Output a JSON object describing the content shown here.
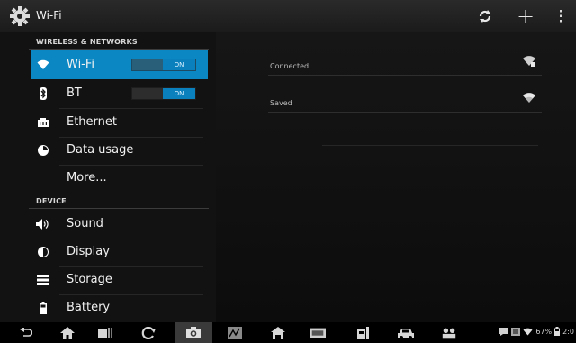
{
  "action_bar": {
    "title": "Wi-Fi",
    "icons": [
      "settings-gear-icon",
      "wps-icon",
      "add-icon",
      "overflow-menu-icon"
    ],
    "add_label": "+"
  },
  "sidebar": {
    "sections": [
      {
        "title": "WIRELESS & NETWORKS"
      },
      {
        "title": "DEVICE"
      }
    ],
    "items": [
      {
        "label": "Wi-Fi",
        "icon": "wifi-icon",
        "toggle": "ON",
        "selected": true
      },
      {
        "label": "BT",
        "icon": "bluetooth-icon",
        "toggle": "ON"
      },
      {
        "label": "Ethernet",
        "icon": "ethernet-icon"
      },
      {
        "label": "Data usage",
        "icon": "data-usage-icon"
      },
      {
        "label": "More...",
        "icon": ""
      },
      {
        "label": "Sound",
        "icon": "sound-icon"
      },
      {
        "label": "Display",
        "icon": "display-icon"
      },
      {
        "label": "Storage",
        "icon": "storage-icon"
      },
      {
        "label": "Battery",
        "icon": "battery-icon"
      }
    ]
  },
  "networks": [
    {
      "label": "Connected",
      "icon": "wifi-lock-icon"
    },
    {
      "label": "Saved",
      "icon": "wifi-signal-icon"
    }
  ],
  "status": {
    "battery": "67%",
    "time": "2:0"
  },
  "colors": {
    "accent": "#0b87c4",
    "toggle_on": "#0a80bd",
    "background": "#0c0c0c"
  }
}
